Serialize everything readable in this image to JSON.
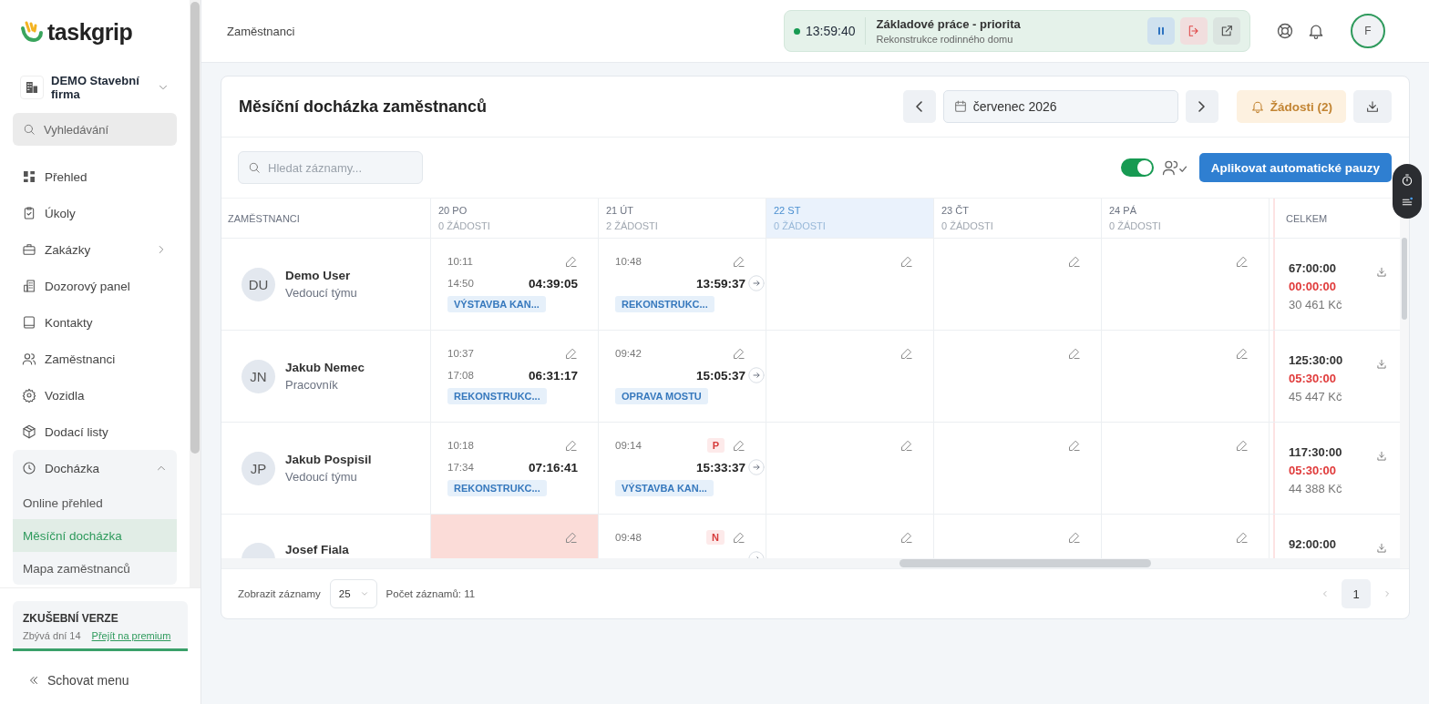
{
  "sidebar": {
    "logo": "taskgrip",
    "company": "DEMO Stavební firma",
    "search_placeholder": "Vyhledávání",
    "items": [
      {
        "label": "Přehled",
        "selected": false
      },
      {
        "label": "Úkoly",
        "selected": false
      },
      {
        "label": "Zakázky",
        "selected": false,
        "has_submenu": true
      },
      {
        "label": "Dozorový panel",
        "selected": false
      },
      {
        "label": "Kontakty",
        "selected": false
      },
      {
        "label": "Zaměstnanci",
        "selected": false
      },
      {
        "label": "Vozidla",
        "selected": false
      },
      {
        "label": "Dodací listy",
        "selected": false
      },
      {
        "label": "Docházka",
        "selected": false,
        "expanded": true,
        "children": [
          {
            "label": "Online přehled",
            "selected": false
          },
          {
            "label": "Měsíční docházka",
            "selected": true
          },
          {
            "label": "Mapa zaměstnanců",
            "selected": false
          }
        ]
      }
    ],
    "trial": {
      "title": "ZKUŠEBNÍ VERZE",
      "days_left": "Zbývá dní 14",
      "link": "Přejít na premium"
    },
    "collapse": "Schovat menu"
  },
  "topbar": {
    "breadcrumb": "Zaměstnanci",
    "timer": {
      "time": "13:59:40",
      "title": "Základové práce - priorita",
      "subtitle": "Rekonstrukce rodinného domu"
    },
    "avatar": "F"
  },
  "card": {
    "title": "Měsíční docházka zaměstnanců",
    "month": "červenec 2026",
    "requests": "Žádosti (2)"
  },
  "toolbar": {
    "search_placeholder": "Hledat záznamy...",
    "toggle": {
      "on": true
    },
    "apply_button": "Aplikovat automatické pauzy"
  },
  "table": {
    "employee_header": "ZAMĚSTNANCI",
    "total_header": "CELKEM",
    "days": [
      {
        "label": "20 PO",
        "requests": "0 ŽÁDOSTI",
        "today": false
      },
      {
        "label": "21 ÚT",
        "requests": "2 ŽÁDOSTI",
        "today": false
      },
      {
        "label": "22 ST",
        "requests": "0 ŽÁDOSTI",
        "today": true
      },
      {
        "label": "23 ČT",
        "requests": "0 ŽÁDOSTI",
        "today": false
      },
      {
        "label": "24 PÁ",
        "requests": "0 ŽÁDOSTI",
        "today": false
      }
    ],
    "rows": [
      {
        "initials": "DU",
        "name": "Demo User",
        "role": "Vedoucí týmu",
        "cells": [
          {
            "kind": "entry",
            "absent": false,
            "in": "10:11",
            "out": "14:50",
            "duration": "04:39:05",
            "tag": "VÝSTAVBA KAN..."
          },
          {
            "kind": "entry",
            "absent": false,
            "in": "10:48",
            "duration": "13:59:37",
            "tag": "REKONSTRUKC...",
            "arrow": true
          },
          {
            "kind": "empty",
            "absent": false
          },
          {
            "kind": "empty",
            "absent": false
          },
          {
            "kind": "empty",
            "absent": false
          }
        ],
        "total": {
          "hours": "67:00:00",
          "overtime": "00:00:00",
          "pay": "30 461 Kč"
        }
      },
      {
        "initials": "JN",
        "name": "Jakub Nemec",
        "role": "Pracovník",
        "cells": [
          {
            "kind": "entry",
            "absent": false,
            "in": "10:37",
            "out": "17:08",
            "duration": "06:31:17",
            "tag": "REKONSTRUKC..."
          },
          {
            "kind": "entry",
            "absent": false,
            "in": "09:42",
            "duration": "15:05:37",
            "tag": "OPRAVA MOSTU",
            "arrow": true
          },
          {
            "kind": "empty",
            "absent": false
          },
          {
            "kind": "empty",
            "absent": false
          },
          {
            "kind": "empty",
            "absent": false
          }
        ],
        "total": {
          "hours": "125:30:00",
          "overtime": "05:30:00",
          "pay": "45 447 Kč"
        }
      },
      {
        "initials": "JP",
        "name": "Jakub Pospisil",
        "role": "Vedoucí týmu",
        "cells": [
          {
            "kind": "entry",
            "absent": false,
            "in": "10:18",
            "out": "17:34",
            "duration": "07:16:41",
            "tag": "REKONSTRUKC..."
          },
          {
            "kind": "entry",
            "absent": false,
            "in": "09:14",
            "badge": "P",
            "duration": "15:33:37",
            "tag": "VÝSTAVBA KAN...",
            "arrow": true
          },
          {
            "kind": "empty",
            "absent": false
          },
          {
            "kind": "empty",
            "absent": false
          },
          {
            "kind": "empty",
            "absent": false
          }
        ],
        "total": {
          "hours": "117:30:00",
          "overtime": "05:30:00",
          "pay": "44 388 Kč"
        }
      },
      {
        "name": "Josef Fiala",
        "cells": [
          {
            "kind": "empty",
            "absent": true
          },
          {
            "kind": "entry",
            "absent": false,
            "in": "09:48",
            "badge": "N",
            "arrow": true
          },
          {
            "kind": "empty",
            "absent": false
          },
          {
            "kind": "empty",
            "absent": false
          },
          {
            "kind": "empty",
            "absent": false
          }
        ],
        "total": {
          "hours": "92:00:00"
        }
      }
    ]
  },
  "footer": {
    "per_page_label": "Zobrazit záznamy",
    "per_page": "25",
    "count": "Počet záznamů: 11",
    "pages": [
      {
        "label": "1",
        "selected": true
      }
    ]
  }
}
